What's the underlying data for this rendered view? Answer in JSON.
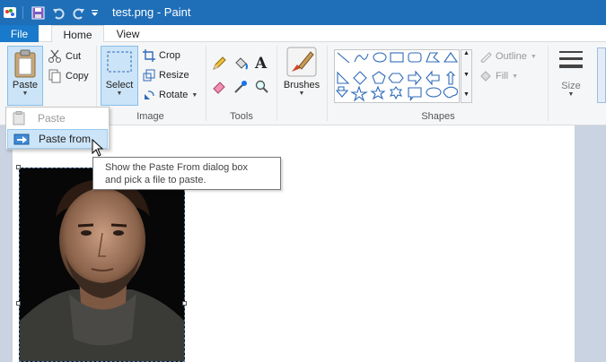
{
  "window": {
    "title": "test.png - Paint",
    "titlebar_color": "#1f6fb8"
  },
  "tabs": {
    "file": "File",
    "home": "Home",
    "view": "View"
  },
  "clipboard": {
    "paste": "Paste",
    "cut": "Cut",
    "copy": "Copy"
  },
  "image": {
    "select": "Select",
    "crop": "Crop",
    "resize": "Resize",
    "rotate": "Rotate",
    "label": "Image"
  },
  "tools": {
    "label": "Tools",
    "items": [
      "pencil-icon",
      "fill-bucket-icon",
      "text-icon",
      "eraser-icon",
      "color-picker-icon",
      "magnifier-icon"
    ]
  },
  "brushes": {
    "label": "Brushes"
  },
  "shapes": {
    "label": "Shapes",
    "outline": "Outline",
    "fill": "Fill"
  },
  "size": {
    "label": "Size"
  },
  "paste_menu": {
    "items": [
      {
        "label": "Paste",
        "enabled": false
      },
      {
        "label": "Paste from",
        "enabled": true
      }
    ]
  },
  "tooltip": {
    "line1": "Show the Paste From dialog box",
    "line2": "and pick a file to paste."
  }
}
